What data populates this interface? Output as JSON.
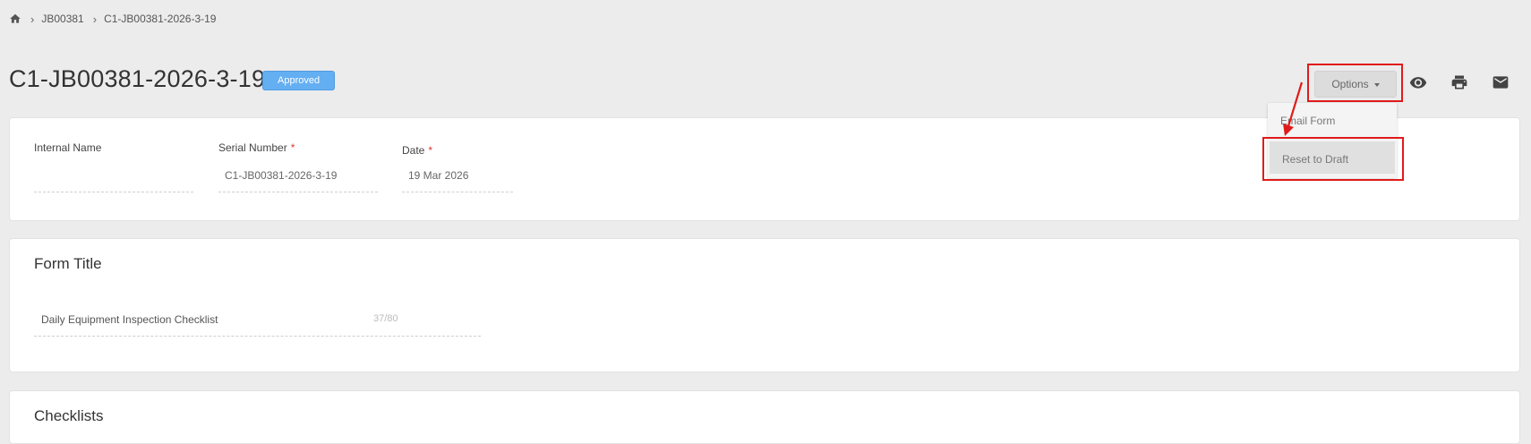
{
  "breadcrumb": {
    "home_icon": "home-icon",
    "items": [
      "JB00381",
      "C1-JB00381-2026-3-19"
    ]
  },
  "header": {
    "title": "C1-JB00381-2026-3-19",
    "status_badge": "Approved",
    "options_label": "Options",
    "icons": [
      "eye-icon",
      "print-icon",
      "mail-icon"
    ]
  },
  "options_menu": {
    "items": [
      "Email Form",
      "Reset to Draft"
    ]
  },
  "details": {
    "internal_name_label": "Internal Name",
    "internal_name_value": "",
    "serial_number_label": "Serial Number",
    "serial_number_value": "C1-JB00381-2026-3-19",
    "date_label": "Date",
    "date_value": "19 Mar 2026",
    "required_marker": "*"
  },
  "form_title_section": {
    "title": "Form Title",
    "value": "Daily Equipment Inspection Checklist",
    "counter": "37/80"
  },
  "checklists_section": {
    "title": "Checklists"
  },
  "colors": {
    "badge": "#64aef2",
    "highlight": "#e01b1b",
    "required": "#e0352f"
  }
}
